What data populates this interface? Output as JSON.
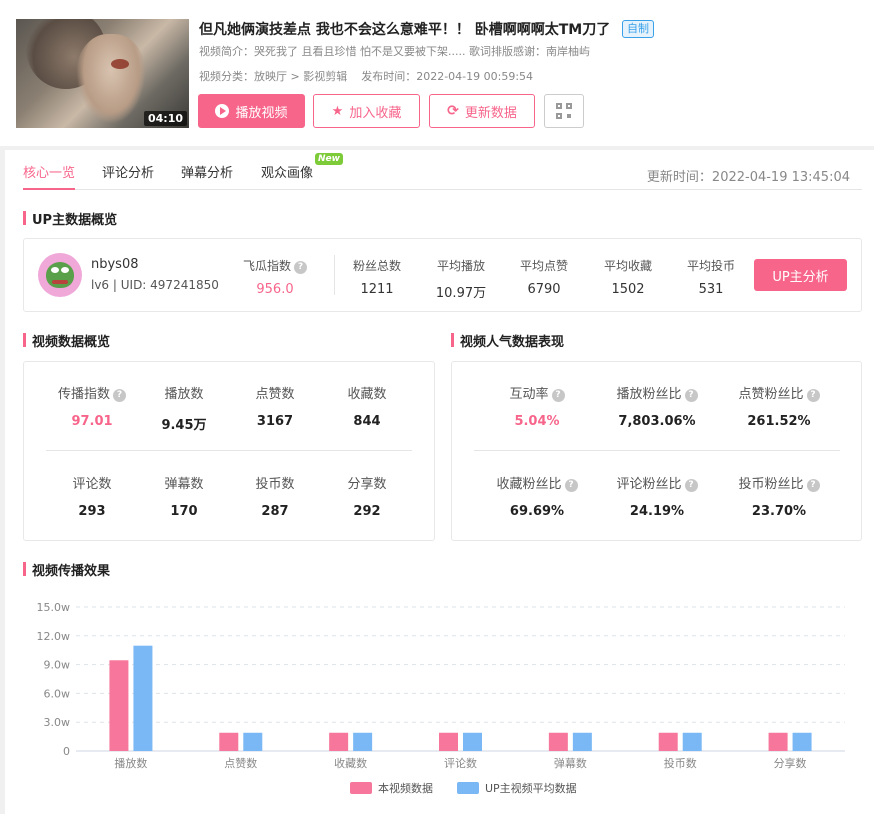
{
  "video": {
    "duration": "04:10",
    "title": "但凡她俩演技差点 我也不会这么意难平！！ 卧槽啊啊啊太TM刀了",
    "tag": "自制",
    "desc_label": "视频简介：",
    "desc": "哭死我了 且看且珍惜 怕不是又要被下架..... 歌词排版感谢：南岸柚屿",
    "category_label": "视频分类：",
    "category": "放映厅 > 影视剪辑",
    "publish_label": "发布时间：",
    "publish_time": "2022-04-19 00:59:54"
  },
  "actions": {
    "play": "播放视频",
    "favorite": "加入收藏",
    "refresh": "更新数据"
  },
  "tabs": [
    {
      "label": "核心一览"
    },
    {
      "label": "评论分析"
    },
    {
      "label": "弹幕分析"
    },
    {
      "label": "观众画像"
    }
  ],
  "new_badge": "New",
  "update_time": "更新时间：2022-04-19 13:45:04",
  "up_section": {
    "title": "UP主数据概览",
    "name": "nbys08",
    "uid": "lv6 | UID: 497241850",
    "feigua_label": "飞瓜指数",
    "feigua_value": "956.0",
    "stats": [
      {
        "label": "粉丝总数",
        "value": "1211"
      },
      {
        "label": "平均播放",
        "value": "10.97万"
      },
      {
        "label": "平均点赞",
        "value": "6790"
      },
      {
        "label": "平均收藏",
        "value": "1502"
      },
      {
        "label": "平均投币",
        "value": "531"
      }
    ],
    "analyze_button": "UP主分析"
  },
  "video_stats": {
    "title": "视频数据概览",
    "items": [
      {
        "label": "传播指数",
        "value": "97.01"
      },
      {
        "label": "播放数",
        "value": "9.45万"
      },
      {
        "label": "点赞数",
        "value": "3167"
      },
      {
        "label": "收藏数",
        "value": "844"
      },
      {
        "label": "评论数",
        "value": "293"
      },
      {
        "label": "弹幕数",
        "value": "170"
      },
      {
        "label": "投币数",
        "value": "287"
      },
      {
        "label": "分享数",
        "value": "292"
      }
    ]
  },
  "popularity": {
    "title": "视频人气数据表现",
    "items": [
      {
        "label": "互动率",
        "value": "5.04%"
      },
      {
        "label": "播放粉丝比",
        "value": "7,803.06%"
      },
      {
        "label": "点赞粉丝比",
        "value": "261.52%"
      },
      {
        "label": "收藏粉丝比",
        "value": "69.69%"
      },
      {
        "label": "评论粉丝比",
        "value": "24.19%"
      },
      {
        "label": "投币粉丝比",
        "value": "23.70%"
      }
    ]
  },
  "chart_section_title": "视频传播效果",
  "colors": {
    "accent": "#f7658b",
    "series1": "#f7779c",
    "series2": "#7ab8f5"
  },
  "chart_data": {
    "type": "bar",
    "categories": [
      "播放数",
      "点赞数",
      "收藏数",
      "评论数",
      "弹幕数",
      "投币数",
      "分享数"
    ],
    "series": [
      {
        "name": "本视频数据",
        "values": [
          9.45,
          1.9,
          1.9,
          1.9,
          1.9,
          1.9,
          1.9
        ]
      },
      {
        "name": "UP主视频平均数据",
        "values": [
          10.97,
          1.9,
          1.9,
          1.9,
          1.9,
          1.9,
          1.9
        ]
      }
    ],
    "yticks": [
      "0",
      "3.0w",
      "6.0w",
      "9.0w",
      "12.0w",
      "15.0w"
    ],
    "ylim": [
      0,
      15
    ],
    "grid": true,
    "legend": "bottom"
  }
}
